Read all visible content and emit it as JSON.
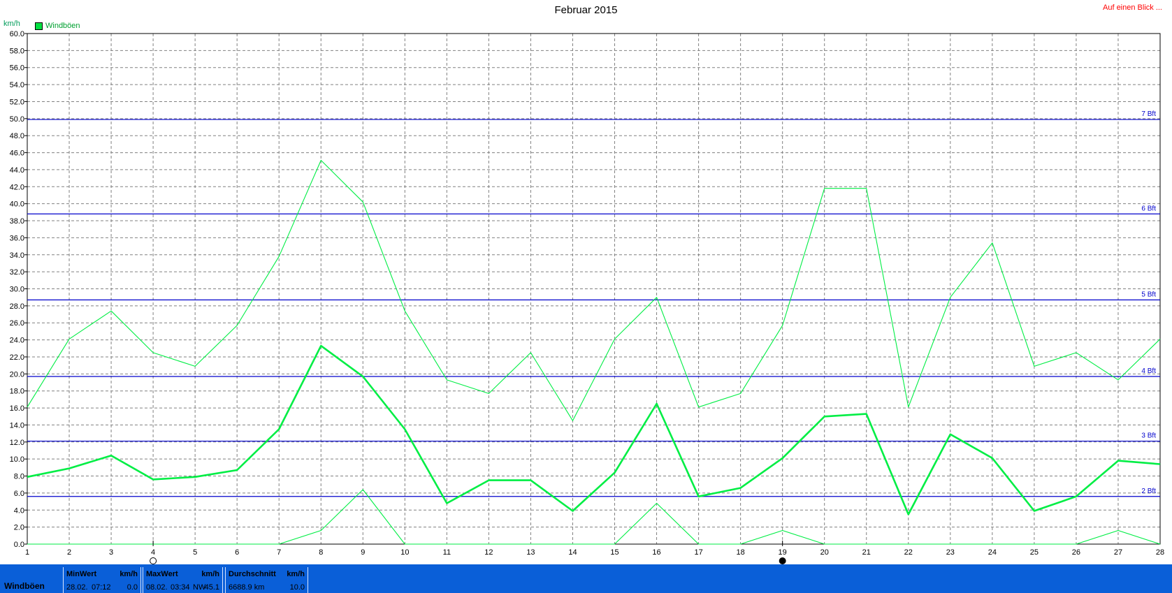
{
  "header": {
    "title": "Februar 2015",
    "top_right_link": "Auf einen Blick ...",
    "unit_label": "km/h"
  },
  "legend": {
    "label": "Windböen"
  },
  "colors": {
    "series": "#00ee44",
    "beaufort_lines": "#0000cc",
    "grid": "#808080",
    "footer_bg": "#0a5fd8"
  },
  "chart_data": {
    "type": "line",
    "title": "Februar 2015",
    "ylabel": "km/h",
    "ylim": [
      0,
      60
    ],
    "y_ticks": [
      "0.0",
      "2.0",
      "4.0",
      "6.0",
      "8.0",
      "10.0",
      "12.0",
      "14.0",
      "16.0",
      "18.0",
      "20.0",
      "22.0",
      "24.0",
      "26.0",
      "28.0",
      "30.0",
      "32.0",
      "34.0",
      "36.0",
      "38.0",
      "40.0",
      "42.0",
      "44.0",
      "46.0",
      "48.0",
      "50.0",
      "52.0",
      "54.0",
      "56.0",
      "58.0",
      "60.0"
    ],
    "x": [
      1,
      2,
      3,
      4,
      5,
      6,
      7,
      8,
      9,
      10,
      11,
      12,
      13,
      14,
      15,
      16,
      17,
      18,
      19,
      20,
      21,
      22,
      23,
      24,
      25,
      26,
      27,
      28
    ],
    "x_tick_labels": [
      "1",
      "2",
      "3",
      "4",
      "5",
      "6",
      "7",
      "8",
      "9",
      "10",
      "11",
      "12",
      "13",
      "14",
      "15",
      "16",
      "17",
      "18",
      "19",
      "20",
      "21",
      "22",
      "23",
      "24",
      "25",
      "26",
      "27",
      "28"
    ],
    "series": [
      {
        "name": "Windböen",
        "role": "max",
        "values": [
          16.1,
          24.1,
          27.4,
          22.5,
          20.9,
          25.7,
          33.8,
          45.1,
          40.2,
          27.4,
          19.3,
          17.7,
          22.5,
          14.5,
          24.1,
          29.0,
          16.1,
          17.7,
          25.7,
          41.8,
          41.8,
          16.1,
          29.0,
          35.4,
          20.9,
          22.5,
          19.3,
          24.1
        ]
      },
      {
        "name": "Windböen",
        "role": "avg",
        "values": [
          7.9,
          8.9,
          10.4,
          7.6,
          7.9,
          8.7,
          13.5,
          23.3,
          19.7,
          13.5,
          4.8,
          7.5,
          7.5,
          3.9,
          8.4,
          16.5,
          5.6,
          6.6,
          10.1,
          15.0,
          15.3,
          3.5,
          12.9,
          10.1,
          3.9,
          5.6,
          9.8,
          9.4
        ]
      },
      {
        "name": "Windböen",
        "role": "min",
        "values": [
          0.0,
          0.0,
          0.0,
          0.0,
          0.0,
          0.0,
          0.0,
          1.6,
          6.4,
          0.0,
          0.0,
          0.0,
          0.0,
          0.0,
          0.0,
          4.8,
          0.0,
          0.0,
          1.6,
          0.0,
          0.0,
          0.0,
          0.0,
          0.0,
          0.0,
          0.0,
          1.6,
          0.0
        ]
      }
    ],
    "reference_lines": [
      {
        "label": "2 Bft",
        "value": 5.6
      },
      {
        "label": "3 Bft",
        "value": 12.1
      },
      {
        "label": "4 Bft",
        "value": 19.7
      },
      {
        "label": "5 Bft",
        "value": 28.7
      },
      {
        "label": "6 Bft",
        "value": 38.8
      },
      {
        "label": "7 Bft",
        "value": 49.9
      }
    ],
    "x_markers": [
      {
        "day": 4,
        "kind": "open-circle"
      },
      {
        "day": 19,
        "kind": "filled-circle"
      }
    ],
    "grid": true,
    "legend_position": "top-left"
  },
  "footer": {
    "row_label": "Windböen",
    "min": {
      "header": "MinWert",
      "unit": "km/h",
      "date": "28.02.",
      "time": "07:12",
      "value": "0.0"
    },
    "max": {
      "header": "MaxWert",
      "unit": "km/h",
      "date": "08.02.",
      "time": "03:34",
      "dir": "NW",
      "value": "45.1"
    },
    "avg": {
      "header": "Durchschnitt",
      "unit": "km/h",
      "distance": "6688.9 km",
      "value": "10.0"
    }
  }
}
